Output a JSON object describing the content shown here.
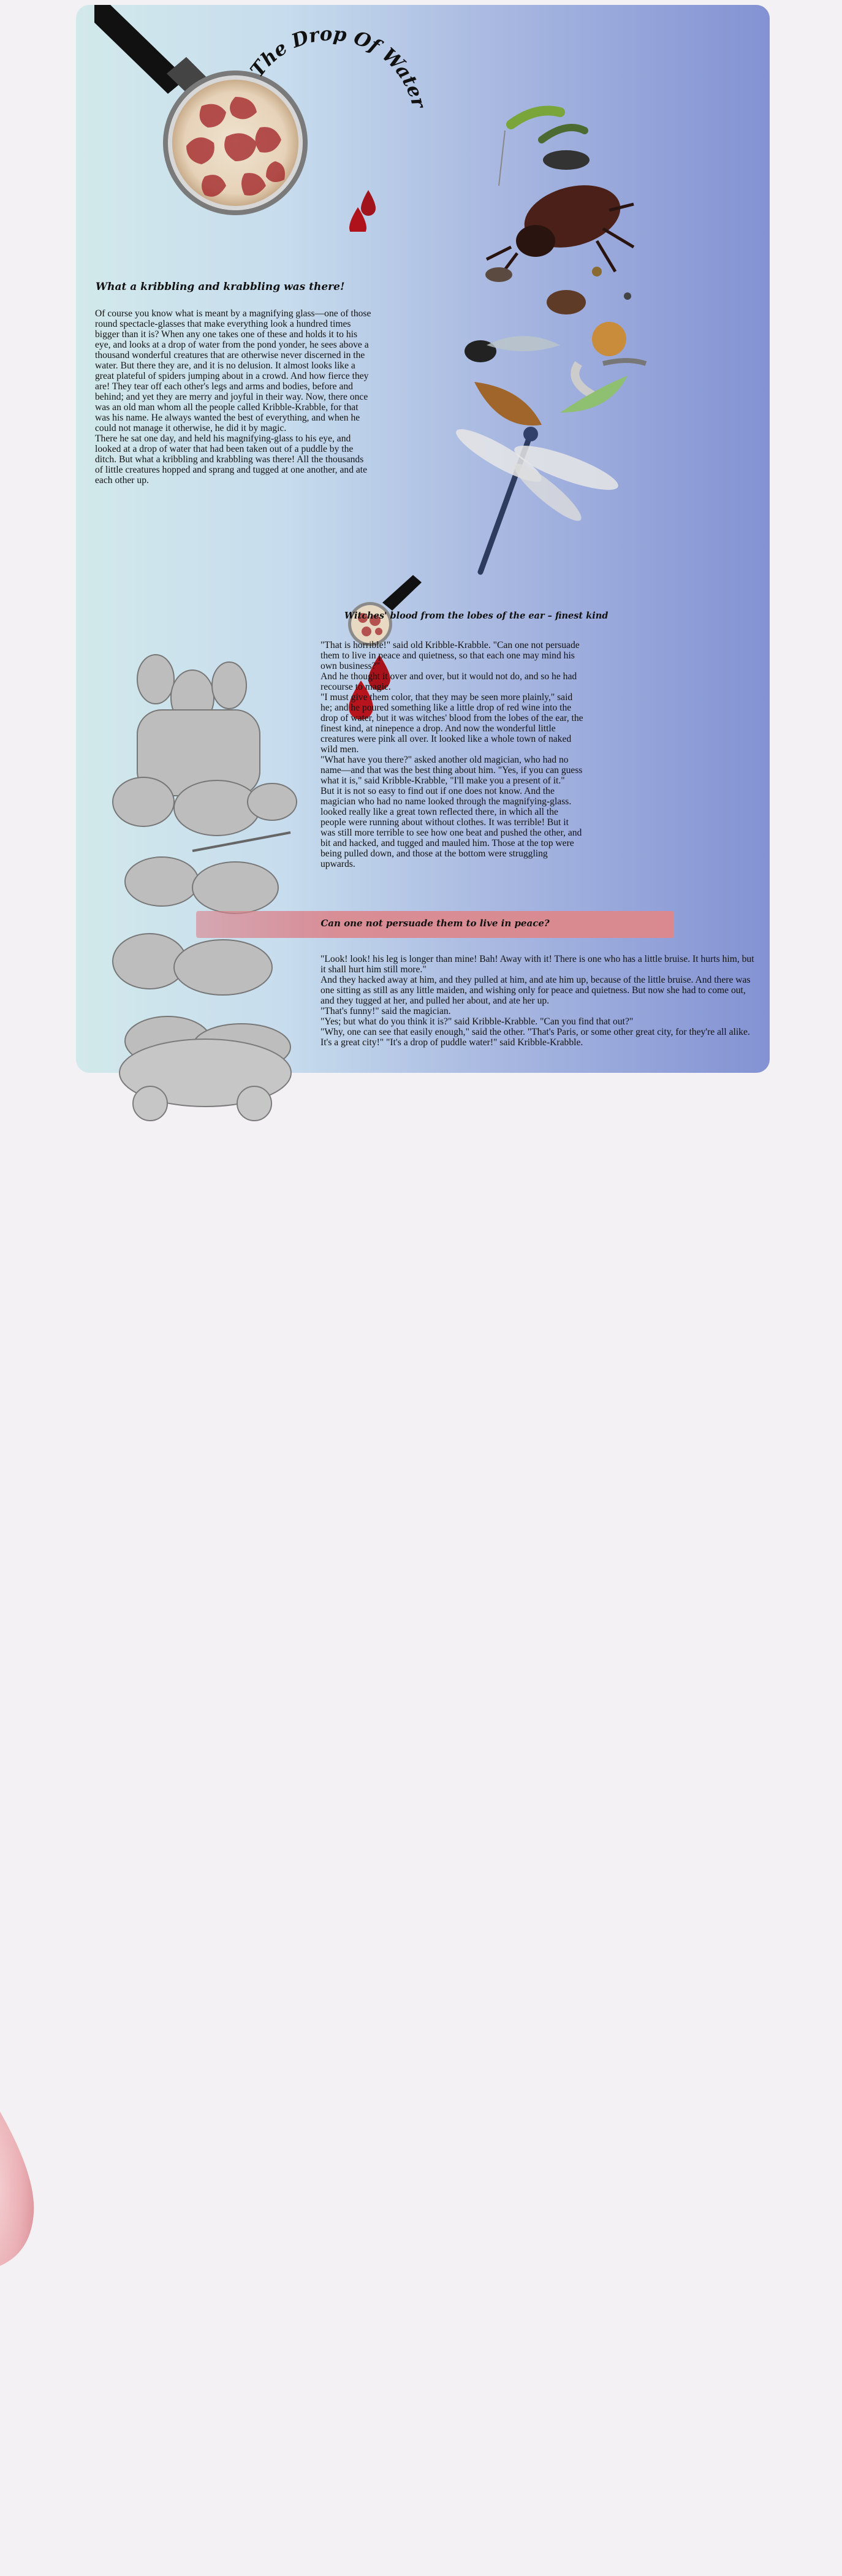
{
  "title": "The Drop Of Water",
  "section1": {
    "heading": "What a kribbling and krabbling was there!",
    "paragraphs": [
      "Of course you know what is meant by a magnifying glass—one of those round spectacle-glasses that make everything look a hundred times bigger than it is? When any one takes one of these and holds it to his eye, and looks at a drop of water from the pond yonder, he sees above a thousand wonderful creatures that are otherwise never discerned in the water. But there they are, and it is no delusion. It almost looks like a great plateful of spiders jumping about in a crowd. And how fierce they are! They tear off each other's legs and arms and bodies, before and behind; and yet they are merry and joyful in their way. Now, there once was an old man whom all the people called Kribble-Krabble, for that was his name. He always wanted the best of everything, and when he could not manage it otherwise, he did it by magic.",
      "There he sat one day, and held his magnifying-glass to his eye, and looked at a drop of water that had been taken out of a puddle by the ditch. But what a kribbling and krabbling was there! All the thousands of little creatures hopped and sprang and tugged at one another, and ate each other up."
    ]
  },
  "section2": {
    "heading": "Witches' blood from the lobes of the ear – finest kind",
    "paragraphs": [
      "\"That is horrible!\" said old Kribble-Krabble. \"Can one not persuade them to live in peace and quietness, so that each one may mind his own business?\"",
      "And he thought it over and over, but it would not do, and so he had recourse to magic.",
      "\"I must give them color, that they may be seen more plainly,\" said he; and he poured something like a little drop of red wine into the drop of water, but it was witches' blood from the lobes of the ear, the finest kind, at ninepence a drop. And now the wonderful little creatures were pink all over. It looked like a whole town of naked wild men.",
      "\"What have you there?\" asked another old magician, who had no name—and that was the best thing about him. \"Yes, if you can guess what it is,\" said Kribble-Krabble, \"I'll make you a present of it.\"",
      "But it is not so easy to find out if one does not know. And the magician who had no name looked through the magnifying-glass. looked really like a great town reflected there, in which all the people were running about without clothes. It was terrible! But it was still more terrible to see how one beat and pushed the other, and bit and hacked, and tugged and mauled him. Those at the top were being pulled down, and those at the bottom were struggling upwards."
    ]
  },
  "banner": "Can one not persuade them to live in peace?",
  "section3": {
    "paragraphs": [
      "\"Look! look! his leg is longer than mine! Bah! Away with it! There is one who has a little bruise. It hurts him, but it shall hurt him still more.\"",
      "And they hacked away at him, and they pulled at him, and ate him up, because of the little bruise. And there was one sitting as still as any little maiden, and wishing only for peace and quietness. But now she had to come out, and they tugged at her, and pulled her about, and ate her up.",
      "\"That's funny!\" said the magician.",
      "\"Yes; but what do you think it is?\" said Kribble-Krabble. \"Can you find that out?\"",
      "\"Why, one can see that easily enough,\" said the other. \"That's Paris, or some other great city, for they're all alike. It's a great city!\" \"It's a drop of puddle water!\" said Kribble-Krabble."
    ]
  }
}
